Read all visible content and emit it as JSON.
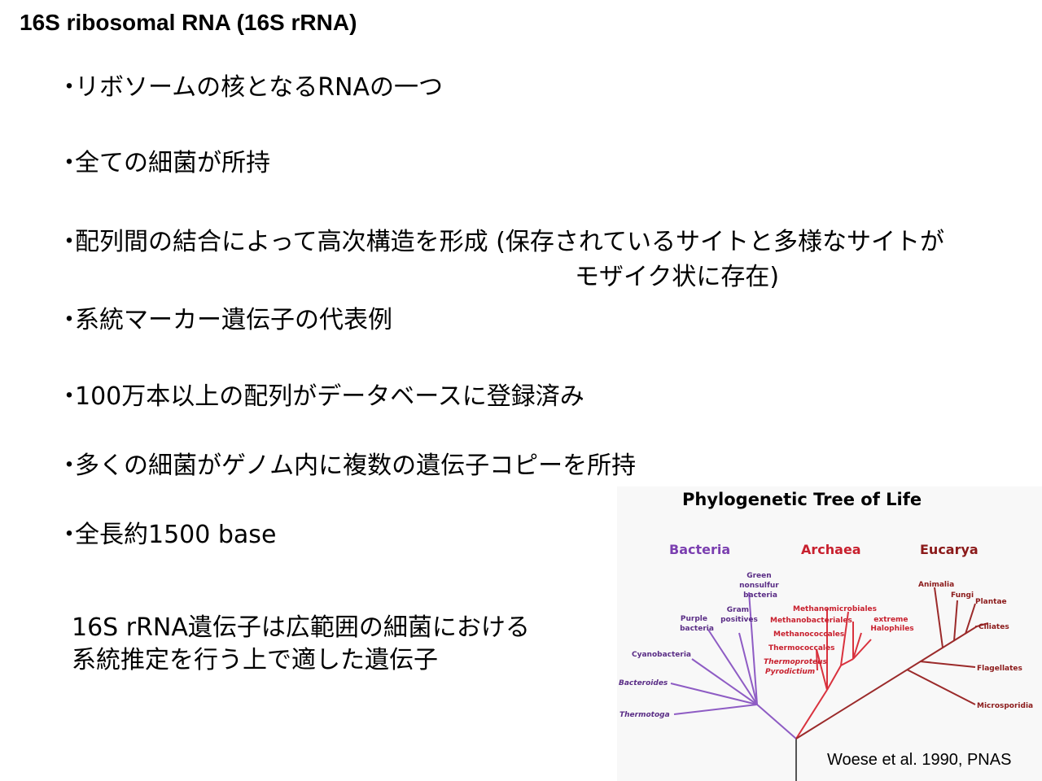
{
  "slide": {
    "title": "16S ribosomal RNA (16S rRNA)",
    "bullet_marker": "・",
    "bullets": [
      "リボソームの核となるRNAの一つ",
      "全ての細菌が所持",
      "配列間の結合によって高次構造を形成 (保存されているサイトと多様なサイトが",
      "系統マーカー遺伝子の代表例",
      "100万本以上の配列がデータベースに登録済み",
      "多くの細菌がゲノム内に複数の遺伝子コピーを所持",
      "全長約1500 base"
    ],
    "bullet3_continuation": "モザイク状に存在)",
    "conclusion_line1": "16S rRNA遺伝子は広範囲の細菌における",
    "conclusion_line2": "系統推定を行う上で適した遺伝子",
    "citation": "Woese  et al. 1990, PNAS"
  },
  "figure": {
    "title": "Phylogenetic Tree of Life",
    "domains": [
      {
        "name": "Bacteria",
        "color": "#7b3fb0"
      },
      {
        "name": "Archaea",
        "color": "#c8202e"
      },
      {
        "name": "Eucarya",
        "color": "#8b1a1a"
      }
    ],
    "bacteria_taxa": [
      "Green",
      "nonsulfur",
      "bacteria",
      "Gram",
      "positives",
      "Purple",
      "bacteria",
      "Cyanobacteria",
      "Bacteroides",
      "Thermotoga"
    ],
    "archaea_taxa": [
      "Methanomicrobiales",
      "Methanobacteriales",
      "Methanococcales",
      "Thermococcales",
      "Thermoproteus",
      "Pyrodictium",
      "extreme",
      "Halophiles"
    ],
    "eucarya_taxa": [
      "Animalia",
      "Fungi",
      "Plantae",
      "Ciliates",
      "Flagellates",
      "Microsporidia"
    ],
    "colors": {
      "bacteria_branch": "#8e5cc4",
      "archaea_branch": "#d9323e",
      "eucarya_branch": "#9b2a2a"
    }
  }
}
